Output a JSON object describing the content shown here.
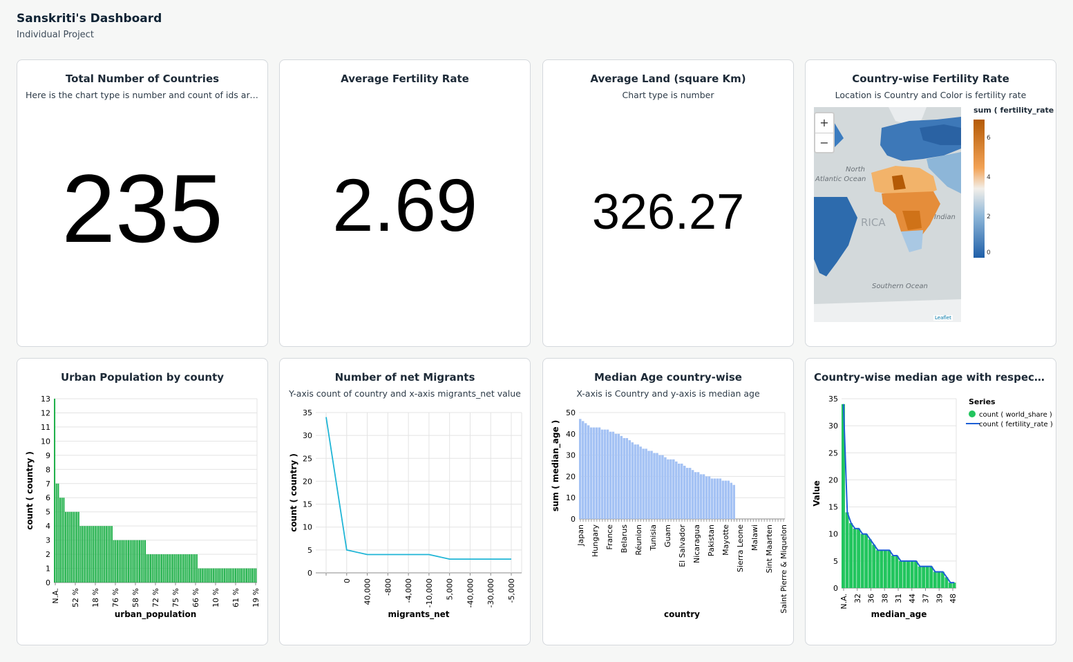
{
  "header": {
    "title": "Sanskriti's Dashboard",
    "subtitle": "Individual Project"
  },
  "cards": {
    "total_countries": {
      "title": "Total Number of Countries",
      "subtitle": "Here is the chart type is number and count of ids are t...",
      "value": "235"
    },
    "avg_fertility": {
      "title": "Average Fertility Rate",
      "subtitle": "",
      "value": "2.69"
    },
    "avg_land": {
      "title": "Average Land (square Km)",
      "subtitle": "Chart type is number",
      "value": "326.27"
    },
    "fertility_map": {
      "title": "Country-wise Fertility Rate",
      "subtitle": "Location is Country and Color is fertility rate",
      "legend_title": "sum ( fertility_rate )",
      "legend_ticks": [
        "6",
        "4",
        "2",
        "0"
      ],
      "zoom_in": "+",
      "zoom_out": "−",
      "labels": [
        "North",
        "Atlantic Ocean",
        "RICA",
        "Indian",
        "Southern Ocean"
      ],
      "attribution": "Leaflet",
      "colors": {
        "low": "#1f5fa8",
        "mid": "#f2efe9",
        "high": "#b45a06",
        "land": "#d3d9db"
      }
    },
    "urban": {
      "title": "Urban Population by county",
      "subtitle": ""
    },
    "migrants": {
      "title": "Number of net Migrants",
      "subtitle": "Y-axis count of country and x-axis migrants_net value"
    },
    "median_age": {
      "title": "Median Age country-wise",
      "subtitle": "X-axis is Country and y-axis is median age"
    },
    "median_share": {
      "title": "Country-wise median age with respect to ...",
      "subtitle": ""
    }
  },
  "chart_data": [
    {
      "type": "bar",
      "xlabel": "urban_population",
      "ylabel": "count ( country )",
      "ylim": [
        0,
        13
      ],
      "yticks": [
        0,
        1,
        2,
        3,
        4,
        5,
        6,
        7,
        8,
        9,
        10,
        11,
        12,
        13
      ],
      "xticks": [
        "N.A.",
        "52 %",
        "18 %",
        "76 %",
        "58 %",
        "72 %",
        "75 %",
        "66 %",
        "10 %",
        "61 %",
        "19 %"
      ],
      "values": [
        13,
        7,
        7,
        6,
        6,
        6,
        5,
        5,
        5,
        5,
        5,
        5,
        5,
        5,
        4,
        4,
        4,
        4,
        4,
        4,
        4,
        4,
        4,
        4,
        4,
        4,
        4,
        4,
        4,
        4,
        4,
        4,
        3,
        3,
        3,
        3,
        3,
        3,
        3,
        3,
        3,
        3,
        3,
        3,
        3,
        3,
        3,
        3,
        3,
        3,
        2,
        2,
        2,
        2,
        2,
        2,
        2,
        2,
        2,
        2,
        2,
        2,
        2,
        2,
        2,
        2,
        2,
        2,
        2,
        2,
        2,
        2,
        2,
        2,
        2,
        2,
        2,
        2,
        1,
        1,
        1,
        1,
        1,
        1,
        1,
        1,
        1,
        1,
        1,
        1,
        1,
        1,
        1,
        1,
        1,
        1,
        1,
        1,
        1,
        1,
        1,
        1,
        1,
        1,
        1,
        1,
        1,
        1,
        1,
        1
      ],
      "color": "#22b14c",
      "grid": true
    },
    {
      "type": "line",
      "xlabel": "migrants_net",
      "ylabel": "count ( country )",
      "ylim": [
        0,
        35
      ],
      "yticks": [
        0,
        5,
        10,
        15,
        20,
        25,
        30,
        35
      ],
      "categories": [
        "",
        "0",
        "40,000",
        "-800",
        "-4,000",
        "-10,000",
        "5,000",
        "-40,000",
        "-30,000",
        "-5,000"
      ],
      "values": [
        34,
        5,
        4,
        4,
        4,
        4,
        3,
        3,
        3,
        3
      ],
      "color": "#1fb5d6",
      "grid": true
    },
    {
      "type": "bar",
      "xlabel": "country",
      "ylabel": "sum ( median_age )",
      "ylim": [
        0,
        50
      ],
      "yticks": [
        0,
        10,
        20,
        30,
        40,
        50
      ],
      "xticks": [
        "Japan",
        "Hungary",
        "France",
        "Belarus",
        "Réunion",
        "Tunisia",
        "Guam",
        "El Salvador",
        "Nicaragua",
        "Pakistan",
        "Mayotte",
        "Sierra Leone",
        "Malawi",
        "Sint Maarten",
        "Saint Pierre & Miquelon"
      ],
      "values": [
        47,
        46,
        45,
        44,
        43,
        43,
        43,
        43,
        42,
        42,
        42,
        41,
        41,
        40,
        40,
        39,
        38,
        38,
        37,
        36,
        35,
        35,
        34,
        33,
        33,
        32,
        32,
        31,
        31,
        30,
        30,
        29,
        28,
        28,
        28,
        27,
        26,
        26,
        25,
        24,
        24,
        23,
        22,
        22,
        21,
        21,
        20,
        20,
        19,
        19,
        19,
        19,
        18,
        18,
        18,
        17,
        16,
        0,
        0,
        0,
        0,
        0,
        0,
        0,
        0,
        0,
        0,
        0,
        0,
        0,
        0,
        0,
        0,
        0,
        0
      ],
      "color": "#a4c2f4",
      "grid": true
    },
    {
      "type": "bar",
      "xlabel": "median_age",
      "ylabel": "Value",
      "ylim": [
        0,
        35
      ],
      "yticks": [
        0,
        5,
        10,
        15,
        20,
        25,
        30,
        35
      ],
      "xticks": [
        "N.A.",
        "32",
        "36",
        "38",
        "31",
        "44",
        "37",
        "39",
        "48"
      ],
      "legend_title": "Series",
      "series": [
        {
          "name": "count ( world_share )",
          "type": "bar",
          "color": "#22c55e",
          "values": [
            34,
            14,
            12,
            11,
            11,
            10,
            10,
            9,
            8,
            7,
            7,
            7,
            7,
            6,
            6,
            5,
            5,
            5,
            5,
            5,
            4,
            4,
            4,
            4,
            3,
            3,
            3,
            2,
            1,
            1
          ]
        },
        {
          "name": "count ( fertility_rate )",
          "type": "line",
          "color": "#1d5fd6",
          "values": [
            34,
            14,
            12,
            11,
            11,
            10,
            10,
            9,
            8,
            7,
            7,
            7,
            7,
            6,
            6,
            5,
            5,
            5,
            5,
            5,
            4,
            4,
            4,
            4,
            3,
            3,
            3,
            2,
            1,
            1
          ]
        }
      ],
      "grid": true
    }
  ]
}
